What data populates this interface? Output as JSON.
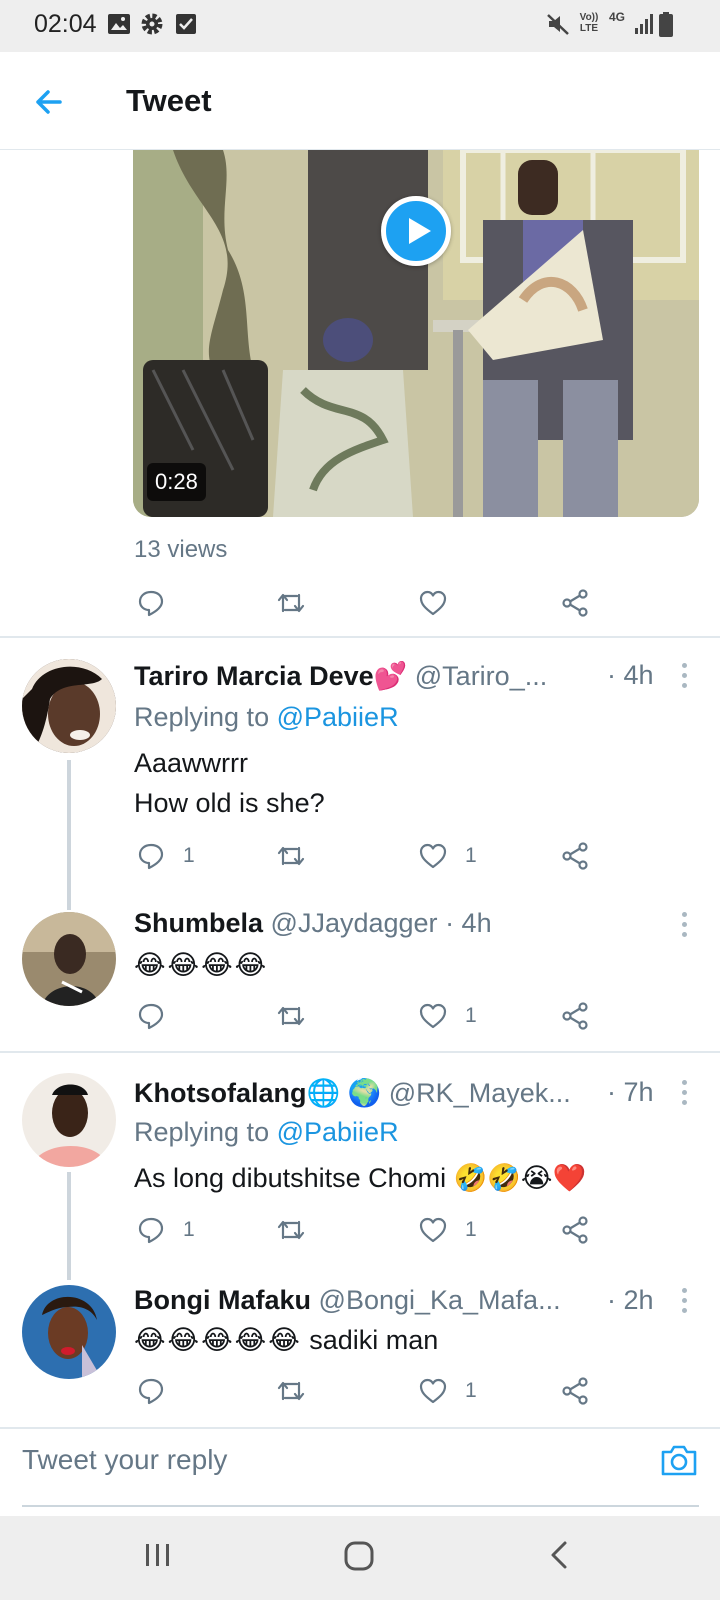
{
  "status_bar": {
    "time": "02:04",
    "left_icons": [
      "image-icon",
      "settings-gear-icon",
      "checkbox-icon"
    ],
    "right_icons": [
      "mute-icon",
      "volte-icon",
      "4g-icon",
      "signal-icon",
      "battery-icon"
    ],
    "volte_label": "Vo)) LTE",
    "network_label": "4G"
  },
  "app_bar": {
    "title": "Tweet",
    "back_icon": "arrow-left-icon"
  },
  "media": {
    "duration": "0:28",
    "play_icon": "play-icon"
  },
  "tweet": {
    "views": "13 views"
  },
  "replies": [
    {
      "name": "Tariro Marcia Deve",
      "name_emoji": "💕",
      "handle": "@Tariro_...",
      "time": "· 4h",
      "replying_prefix": "Replying to",
      "replying_to": "@PabiieR",
      "lines": [
        "Aaawwrrr",
        "How old is she?"
      ],
      "reply_count": "1",
      "retweet_count": "",
      "like_count": "1"
    },
    {
      "name": "Shumbela",
      "handle": "@JJaydagger",
      "time": "· 4h",
      "emoji_text": "😂😂😂😂",
      "reply_count": "",
      "retweet_count": "",
      "like_count": "1"
    },
    {
      "name": "Khotsofalang",
      "name_emoji": "🌐 🌍",
      "handle": "@RK_Mayek...",
      "time": "· 7h",
      "replying_prefix": "Replying to",
      "replying_to": "@PabiieR",
      "text": "As long dibutshitse Chomi",
      "text_emoji": "🤣🤣😭❤️",
      "reply_count": "1",
      "retweet_count": "",
      "like_count": "1"
    },
    {
      "name": "Bongi Mafaku",
      "handle": "@Bongi_Ka_Mafa...",
      "time": "· 2h",
      "emoji_text": "😂😂😂😂😂",
      "text": "sadiki man",
      "reply_count": "",
      "retweet_count": "",
      "like_count": "1"
    }
  ],
  "compose": {
    "placeholder": "Tweet your reply",
    "camera_icon": "camera-icon"
  },
  "nav_bar": {
    "buttons": [
      "recents-button",
      "home-button",
      "back-button"
    ]
  },
  "colors": {
    "accent": "#1da1f2",
    "mention": "#1b95e0",
    "muted": "#657786",
    "divider": "#e1e8ed"
  }
}
